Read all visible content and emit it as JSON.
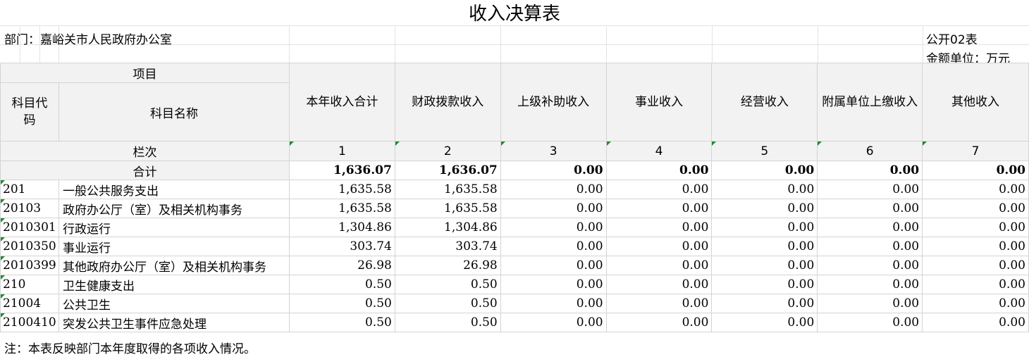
{
  "title": "收入决算表",
  "department": "部门：嘉峪关市人民政府办公室",
  "form_code": "公开02表",
  "unit": "金额单位：万元",
  "header": {
    "project": "项目",
    "code": "科目代码",
    "name": "科目名称",
    "columns": [
      "本年收入合计",
      "财政拨款收入",
      "上级补助收入",
      "事业收入",
      "经营收入",
      "附属单位上缴收入",
      "其他收入"
    ],
    "row_label": "栏次",
    "row_numbers": [
      "1",
      "2",
      "3",
      "4",
      "5",
      "6",
      "7"
    ]
  },
  "total": {
    "label": "合计",
    "values": [
      "1,636.07",
      "1,636.07",
      "0.00",
      "0.00",
      "0.00",
      "0.00",
      "0.00"
    ]
  },
  "rows": [
    {
      "code": "201",
      "name": "一般公共服务支出",
      "values": [
        "1,635.58",
        "1,635.58",
        "0.00",
        "0.00",
        "0.00",
        "0.00",
        "0.00"
      ]
    },
    {
      "code": "20103",
      "name": "政府办公厅（室）及相关机构事务",
      "values": [
        "1,635.58",
        "1,635.58",
        "0.00",
        "0.00",
        "0.00",
        "0.00",
        "0.00"
      ]
    },
    {
      "code": "2010301",
      "name": "行政运行",
      "values": [
        "1,304.86",
        "1,304.86",
        "0.00",
        "0.00",
        "0.00",
        "0.00",
        "0.00"
      ]
    },
    {
      "code": "2010350",
      "name": "事业运行",
      "values": [
        "303.74",
        "303.74",
        "0.00",
        "0.00",
        "0.00",
        "0.00",
        "0.00"
      ]
    },
    {
      "code": "2010399",
      "name": "其他政府办公厅（室）及相关机构事务",
      "values": [
        "26.98",
        "26.98",
        "0.00",
        "0.00",
        "0.00",
        "0.00",
        "0.00"
      ]
    },
    {
      "code": "210",
      "name": "卫生健康支出",
      "values": [
        "0.50",
        "0.50",
        "0.00",
        "0.00",
        "0.00",
        "0.00",
        "0.00"
      ]
    },
    {
      "code": "21004",
      "name": "公共卫生",
      "values": [
        "0.50",
        "0.50",
        "0.00",
        "0.00",
        "0.00",
        "0.00",
        "0.00"
      ]
    },
    {
      "code": "2100410",
      "name": "突发公共卫生事件应急处理",
      "values": [
        "0.50",
        "0.50",
        "0.00",
        "0.00",
        "0.00",
        "0.00",
        "0.00"
      ]
    }
  ],
  "note": "注：本表反映部门本年度取得的各项收入情况。"
}
